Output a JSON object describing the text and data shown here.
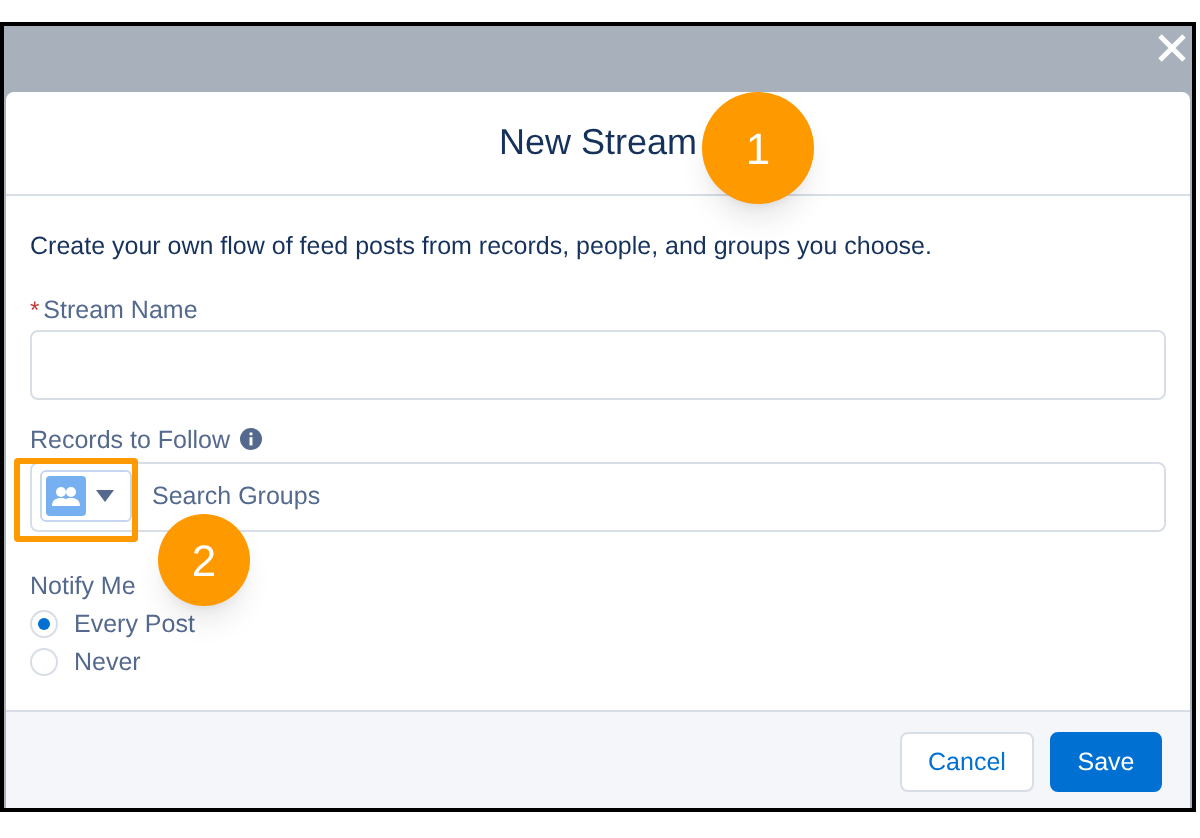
{
  "modal": {
    "title": "New Stream",
    "description": "Create your own flow of feed posts from records, people, and groups you choose.",
    "stream_name": {
      "label": "Stream Name",
      "required": true,
      "required_mark": "*"
    },
    "records_to_follow": {
      "label": "Records to Follow",
      "placeholder": "Search Groups"
    },
    "notify_me": {
      "label": "Notify Me",
      "options": [
        {
          "label": "Every Post",
          "selected": true
        },
        {
          "label": "Never",
          "selected": false
        }
      ]
    },
    "buttons": [
      {
        "label": "Cancel",
        "kind": "neutral"
      },
      {
        "label": "Save",
        "kind": "brand"
      }
    ]
  },
  "callouts": [
    "1",
    "2"
  ]
}
